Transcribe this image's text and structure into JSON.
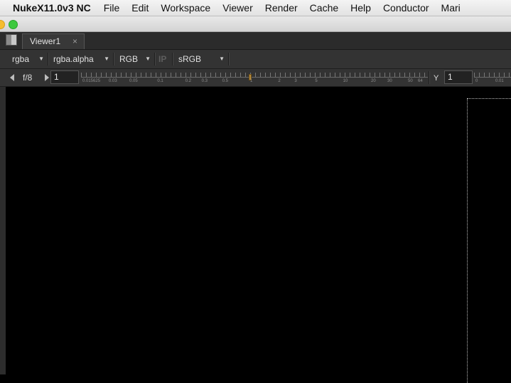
{
  "menubar": {
    "app_name": "NukeX11.0v3 NC",
    "items": [
      "File",
      "Edit",
      "Workspace",
      "Viewer",
      "Render",
      "Cache",
      "Help",
      "Conductor",
      "Mari"
    ]
  },
  "tabs": {
    "active_label": "Viewer1",
    "close_glyph": "×"
  },
  "toolbar": {
    "channels": "rgba",
    "alpha_channel": "rgba.alpha",
    "display_mode": "RGB",
    "ip_label": "IP",
    "colorspace": "sRGB",
    "dropdown_arrow": "▼"
  },
  "gainbar": {
    "fstop_label": "f/8",
    "gain_value": "1",
    "gain_tick_labels": [
      "0.015625",
      "0.03",
      "0.05",
      "0.1",
      "0.2",
      "0.3",
      "0.5",
      "1",
      "2",
      "3",
      "5",
      "10",
      "20",
      "30",
      "50",
      "64"
    ],
    "gain_level": "1",
    "gamma_label": "Y",
    "gamma_value": "1",
    "gamma_tick_labels": [
      "0",
      "0.01"
    ]
  },
  "colors": {
    "accent_red": "#f00000",
    "panel_bg": "#333333",
    "viewer_bg": "#000000",
    "handle": "#b58a3a"
  }
}
